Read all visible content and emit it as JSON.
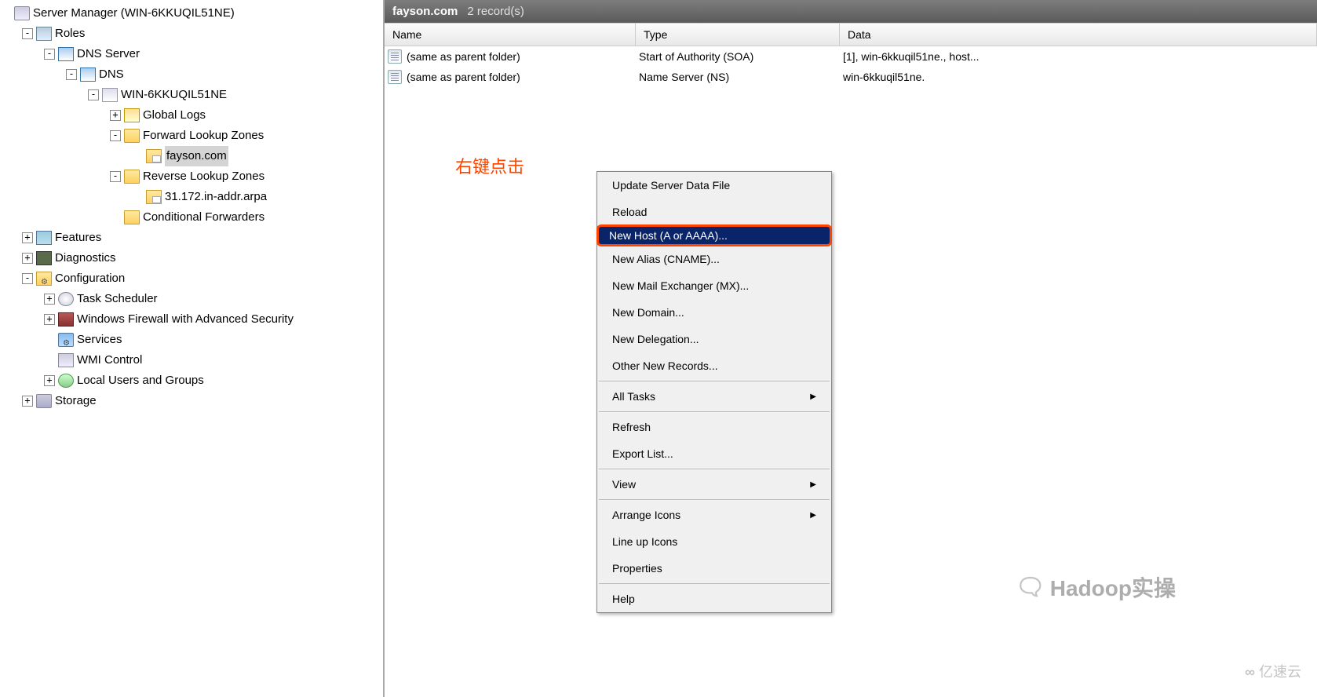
{
  "tree": {
    "root": "Server Manager (WIN-6KKUQIL51NE)",
    "roles": "Roles",
    "dns_server": "DNS Server",
    "dns": "DNS",
    "host": "WIN-6KKUQIL51NE",
    "global_logs": "Global Logs",
    "fwd_zones": "Forward Lookup Zones",
    "fayson": "fayson.com",
    "rev_zones": "Reverse Lookup Zones",
    "rev_zone1": "31.172.in-addr.arpa",
    "cond_fwd": "Conditional Forwarders",
    "features": "Features",
    "diagnostics": "Diagnostics",
    "configuration": "Configuration",
    "task_sched": "Task Scheduler",
    "firewall": "Windows Firewall with Advanced Security",
    "services": "Services",
    "wmi": "WMI Control",
    "local_users": "Local Users and Groups",
    "storage": "Storage"
  },
  "header": {
    "title": "fayson.com",
    "count": "2 record(s)"
  },
  "columns": {
    "c1": "Name",
    "c2": "Type",
    "c3": "Data"
  },
  "rows": [
    {
      "name": "(same as parent folder)",
      "type": "Start of Authority (SOA)",
      "data": "[1], win-6kkuqil51ne., host..."
    },
    {
      "name": "(same as parent folder)",
      "type": "Name Server (NS)",
      "data": "win-6kkuqil51ne."
    }
  ],
  "annotation": "右键点击",
  "ctx": {
    "update": "Update Server Data File",
    "reload": "Reload",
    "new_host": "New Host (A or AAAA)...",
    "new_alias": "New Alias (CNAME)...",
    "new_mx": "New Mail Exchanger (MX)...",
    "new_domain": "New Domain...",
    "new_deleg": "New Delegation...",
    "other_new": "Other New Records...",
    "all_tasks": "All Tasks",
    "refresh": "Refresh",
    "export": "Export List...",
    "view": "View",
    "arrange": "Arrange Icons",
    "lineup": "Line up Icons",
    "props": "Properties",
    "help": "Help"
  },
  "watermarks": {
    "w1": "Hadoop实操",
    "w2": "亿速云"
  }
}
